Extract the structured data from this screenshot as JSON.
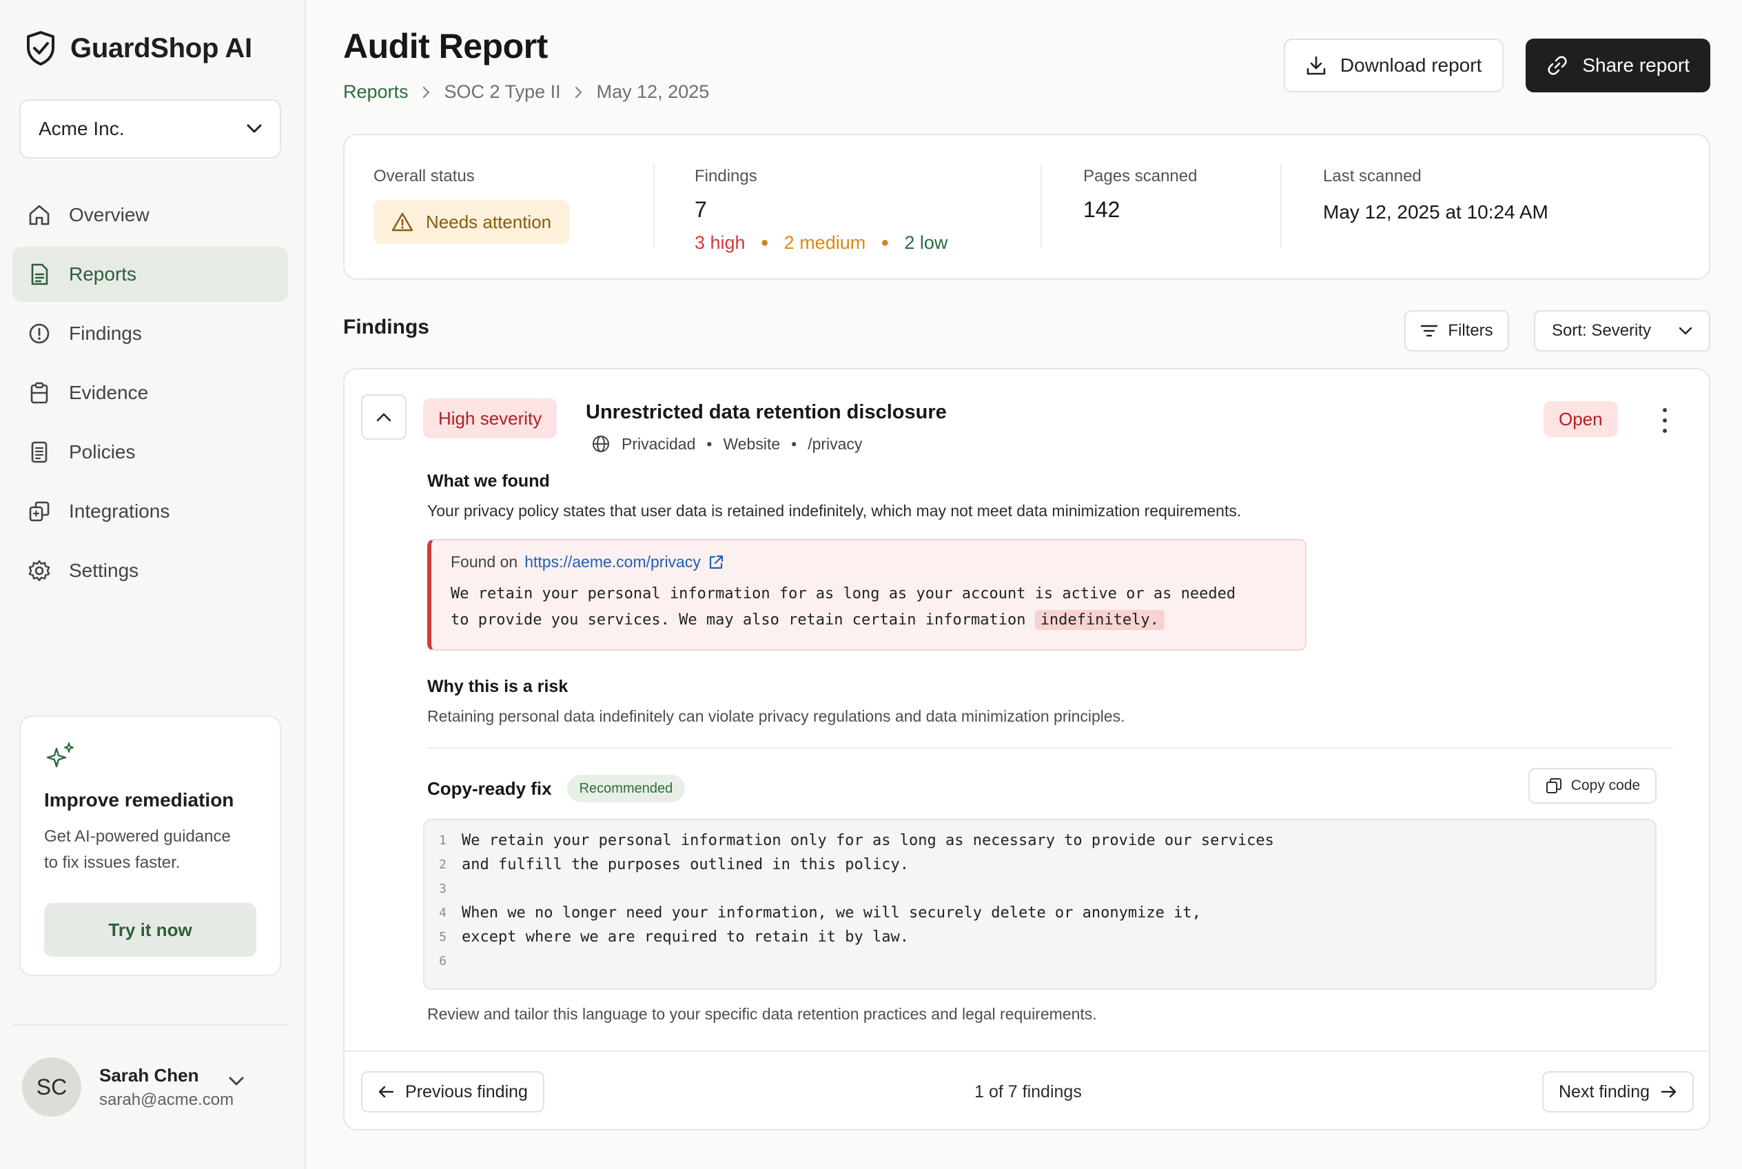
{
  "app": {
    "name": "GuardShop AI"
  },
  "org": {
    "selected": "Acme Inc."
  },
  "sidebar": {
    "items": [
      {
        "label": "Overview",
        "icon": "home-icon"
      },
      {
        "label": "Reports",
        "icon": "document-icon",
        "active": true
      },
      {
        "label": "Findings",
        "icon": "alert-circle-icon"
      },
      {
        "label": "Evidence",
        "icon": "clipboard-icon"
      },
      {
        "label": "Policies",
        "icon": "file-text-icon"
      },
      {
        "label": "Integrations",
        "icon": "copy-squares-icon"
      },
      {
        "label": "Settings",
        "icon": "gear-icon"
      }
    ]
  },
  "promo": {
    "icon": "sparkles-icon",
    "title": "Improve remediation",
    "text_line1": "Get AI-powered guidance",
    "text_line2": "to fix issues faster.",
    "button": "Try it now"
  },
  "user": {
    "initials": "SC",
    "name": "Sarah Chen",
    "email": "sarah@acme.com"
  },
  "header": {
    "title": "Audit Report",
    "breadcrumb": [
      "Reports",
      "SOC 2 Type II",
      "May 12, 2025"
    ],
    "download_label": "Download report",
    "share_label": "Share report"
  },
  "summary": {
    "status_label": "Overall status",
    "status_value": "Needs attention",
    "findings_label": "Findings",
    "findings_count": "7",
    "high": "3 high",
    "medium": "2 medium",
    "low": "2 low",
    "pages_label": "Pages scanned",
    "pages_value": "142",
    "last_label": "Last scanned",
    "last_value": "May 12, 2025 at 10:24 AM"
  },
  "findings_toolbar": {
    "title": "Findings",
    "filters": "Filters",
    "sort": "Sort: Severity"
  },
  "finding": {
    "severity": "High severity",
    "title": "Unrestricted data retention disclosure",
    "meta_source": "Privacidad",
    "meta_type": "Website",
    "meta_path": "/privacy",
    "status": "Open",
    "found_head": "What we found",
    "found_text": "Your privacy policy states that user data is retained indefinitely, which may not meet data minimization requirements.",
    "found_on_label": "Found on",
    "found_on_url": "https://aeme.com/privacy",
    "quote_line1": "We retain your personal information for as long as your account is active or as needed",
    "quote_line2_pre": "to provide you services. We may also retain certain information ",
    "quote_highlight": "indefinitely.",
    "risk_head": "Why this is a risk",
    "risk_text": "Retaining personal data indefinitely can violate privacy regulations and data minimization principles.",
    "fix_title": "Copy-ready fix",
    "fix_badge": "Recommended",
    "copy_label": "Copy code",
    "code_lines": [
      "We retain your personal information only for as long as necessary to provide our services",
      "and fulfill the purposes outlined in this policy.",
      "",
      "When we no longer need your information, we will securely delete or anonymize it,",
      "except where we are required to retain it by law.",
      ""
    ],
    "fix_note": "Review and tailor this language to your specific data retention practices and legal requirements.",
    "prev": "Previous finding",
    "pager": "1 of 7 findings",
    "next": "Next finding"
  }
}
